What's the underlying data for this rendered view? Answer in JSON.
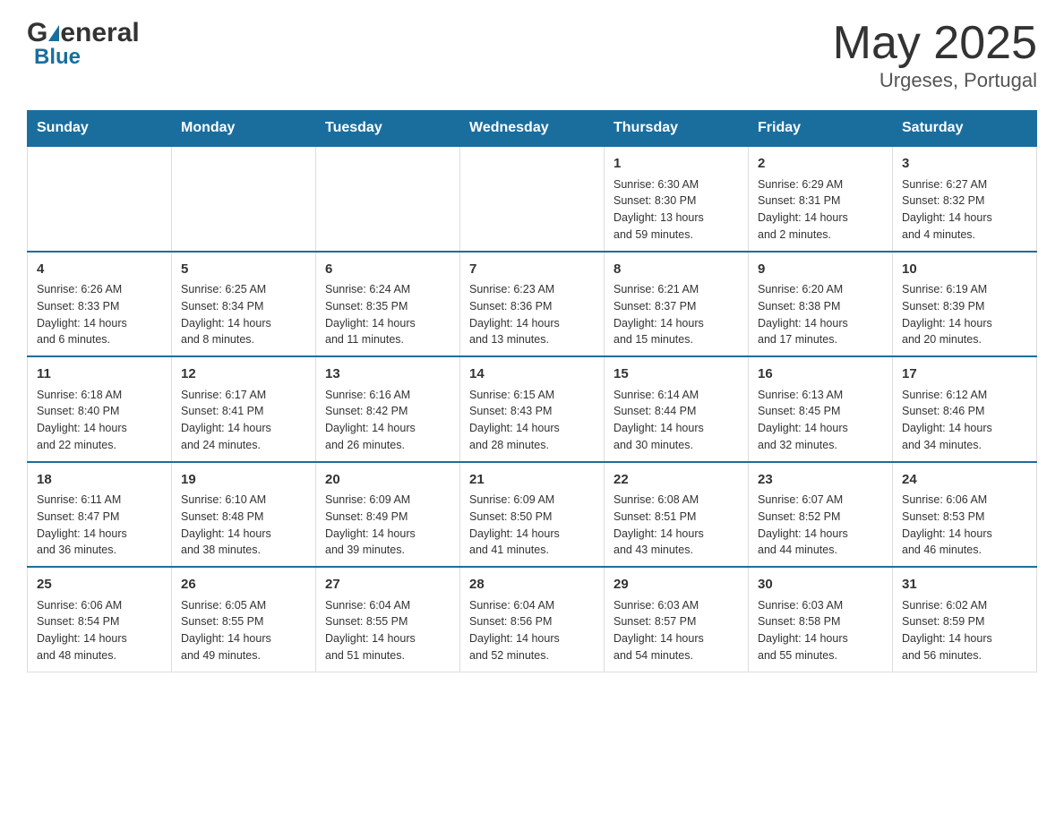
{
  "header": {
    "logo_general": "General",
    "logo_blue": "Blue",
    "month_title": "May 2025",
    "location": "Urgeses, Portugal"
  },
  "days_of_week": [
    "Sunday",
    "Monday",
    "Tuesday",
    "Wednesday",
    "Thursday",
    "Friday",
    "Saturday"
  ],
  "weeks": [
    [
      {
        "day": "",
        "info": ""
      },
      {
        "day": "",
        "info": ""
      },
      {
        "day": "",
        "info": ""
      },
      {
        "day": "",
        "info": ""
      },
      {
        "day": "1",
        "info": "Sunrise: 6:30 AM\nSunset: 8:30 PM\nDaylight: 13 hours\nand 59 minutes."
      },
      {
        "day": "2",
        "info": "Sunrise: 6:29 AM\nSunset: 8:31 PM\nDaylight: 14 hours\nand 2 minutes."
      },
      {
        "day": "3",
        "info": "Sunrise: 6:27 AM\nSunset: 8:32 PM\nDaylight: 14 hours\nand 4 minutes."
      }
    ],
    [
      {
        "day": "4",
        "info": "Sunrise: 6:26 AM\nSunset: 8:33 PM\nDaylight: 14 hours\nand 6 minutes."
      },
      {
        "day": "5",
        "info": "Sunrise: 6:25 AM\nSunset: 8:34 PM\nDaylight: 14 hours\nand 8 minutes."
      },
      {
        "day": "6",
        "info": "Sunrise: 6:24 AM\nSunset: 8:35 PM\nDaylight: 14 hours\nand 11 minutes."
      },
      {
        "day": "7",
        "info": "Sunrise: 6:23 AM\nSunset: 8:36 PM\nDaylight: 14 hours\nand 13 minutes."
      },
      {
        "day": "8",
        "info": "Sunrise: 6:21 AM\nSunset: 8:37 PM\nDaylight: 14 hours\nand 15 minutes."
      },
      {
        "day": "9",
        "info": "Sunrise: 6:20 AM\nSunset: 8:38 PM\nDaylight: 14 hours\nand 17 minutes."
      },
      {
        "day": "10",
        "info": "Sunrise: 6:19 AM\nSunset: 8:39 PM\nDaylight: 14 hours\nand 20 minutes."
      }
    ],
    [
      {
        "day": "11",
        "info": "Sunrise: 6:18 AM\nSunset: 8:40 PM\nDaylight: 14 hours\nand 22 minutes."
      },
      {
        "day": "12",
        "info": "Sunrise: 6:17 AM\nSunset: 8:41 PM\nDaylight: 14 hours\nand 24 minutes."
      },
      {
        "day": "13",
        "info": "Sunrise: 6:16 AM\nSunset: 8:42 PM\nDaylight: 14 hours\nand 26 minutes."
      },
      {
        "day": "14",
        "info": "Sunrise: 6:15 AM\nSunset: 8:43 PM\nDaylight: 14 hours\nand 28 minutes."
      },
      {
        "day": "15",
        "info": "Sunrise: 6:14 AM\nSunset: 8:44 PM\nDaylight: 14 hours\nand 30 minutes."
      },
      {
        "day": "16",
        "info": "Sunrise: 6:13 AM\nSunset: 8:45 PM\nDaylight: 14 hours\nand 32 minutes."
      },
      {
        "day": "17",
        "info": "Sunrise: 6:12 AM\nSunset: 8:46 PM\nDaylight: 14 hours\nand 34 minutes."
      }
    ],
    [
      {
        "day": "18",
        "info": "Sunrise: 6:11 AM\nSunset: 8:47 PM\nDaylight: 14 hours\nand 36 minutes."
      },
      {
        "day": "19",
        "info": "Sunrise: 6:10 AM\nSunset: 8:48 PM\nDaylight: 14 hours\nand 38 minutes."
      },
      {
        "day": "20",
        "info": "Sunrise: 6:09 AM\nSunset: 8:49 PM\nDaylight: 14 hours\nand 39 minutes."
      },
      {
        "day": "21",
        "info": "Sunrise: 6:09 AM\nSunset: 8:50 PM\nDaylight: 14 hours\nand 41 minutes."
      },
      {
        "day": "22",
        "info": "Sunrise: 6:08 AM\nSunset: 8:51 PM\nDaylight: 14 hours\nand 43 minutes."
      },
      {
        "day": "23",
        "info": "Sunrise: 6:07 AM\nSunset: 8:52 PM\nDaylight: 14 hours\nand 44 minutes."
      },
      {
        "day": "24",
        "info": "Sunrise: 6:06 AM\nSunset: 8:53 PM\nDaylight: 14 hours\nand 46 minutes."
      }
    ],
    [
      {
        "day": "25",
        "info": "Sunrise: 6:06 AM\nSunset: 8:54 PM\nDaylight: 14 hours\nand 48 minutes."
      },
      {
        "day": "26",
        "info": "Sunrise: 6:05 AM\nSunset: 8:55 PM\nDaylight: 14 hours\nand 49 minutes."
      },
      {
        "day": "27",
        "info": "Sunrise: 6:04 AM\nSunset: 8:55 PM\nDaylight: 14 hours\nand 51 minutes."
      },
      {
        "day": "28",
        "info": "Sunrise: 6:04 AM\nSunset: 8:56 PM\nDaylight: 14 hours\nand 52 minutes."
      },
      {
        "day": "29",
        "info": "Sunrise: 6:03 AM\nSunset: 8:57 PM\nDaylight: 14 hours\nand 54 minutes."
      },
      {
        "day": "30",
        "info": "Sunrise: 6:03 AM\nSunset: 8:58 PM\nDaylight: 14 hours\nand 55 minutes."
      },
      {
        "day": "31",
        "info": "Sunrise: 6:02 AM\nSunset: 8:59 PM\nDaylight: 14 hours\nand 56 minutes."
      }
    ]
  ]
}
